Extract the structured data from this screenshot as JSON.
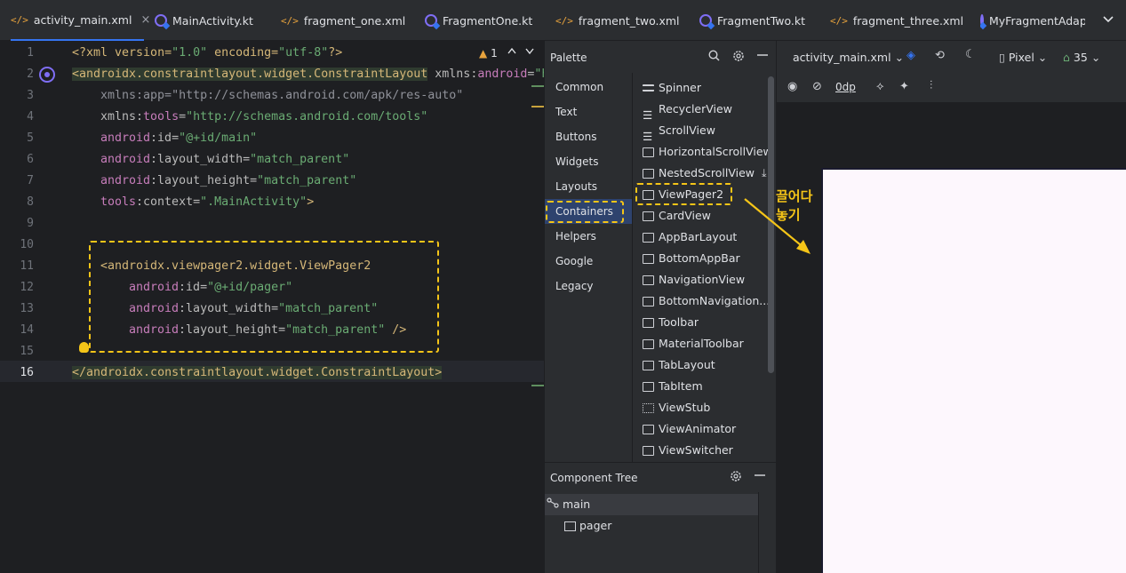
{
  "tabs": [
    {
      "label": "activity_main.xml",
      "icon": "xml-icon",
      "active": true,
      "closable": true
    },
    {
      "label": "MainActivity.kt",
      "icon": "kotlin-class-icon"
    },
    {
      "label": "fragment_one.xml",
      "icon": "xml-icon"
    },
    {
      "label": "FragmentOne.kt",
      "icon": "kotlin-class-icon"
    },
    {
      "label": "fragment_two.xml",
      "icon": "xml-icon"
    },
    {
      "label": "FragmentTwo.kt",
      "icon": "kotlin-class-icon"
    },
    {
      "label": "fragment_three.xml",
      "icon": "xml-icon"
    },
    {
      "label": "MyFragmentAdapte",
      "icon": "kotlin-class-icon"
    }
  ],
  "tab_more": "⌄",
  "editor": {
    "warning_count": "1",
    "line_numbers": [
      "1",
      "2",
      "3",
      "4",
      "5",
      "6",
      "7",
      "8",
      "9",
      "10",
      "11",
      "12",
      "13",
      "14",
      "15",
      "16"
    ],
    "lines": {
      "l1_a": "<?xml version=",
      "l1_b": "\"1.0\"",
      "l1_c": " encoding=",
      "l1_d": "\"utf-8\"",
      "l1_e": "?>",
      "l2_a": "<androidx.constraintlayout.widget.ConstraintLayout",
      "l2_b": " xmlns:",
      "l2_c": "android",
      "l2_d": "=",
      "l2_e": "\"h",
      "l3_a": "xmlns:app=",
      "l3_b": "\"http://schemas.android.com/apk/res-auto\"",
      "l4_a": "xmlns:",
      "l4_b": "tools",
      "l4_c": "=",
      "l4_d": "\"http://schemas.android.com/tools\"",
      "l5_ns": "android",
      "l5_a": ":id=",
      "l5_b": "\"@+id/main\"",
      "l6_ns": "android",
      "l6_a": ":layout_width=",
      "l6_b": "\"match_parent\"",
      "l7_ns": "android",
      "l7_a": ":layout_height=",
      "l7_b": "\"match_parent\"",
      "l8_ns": "tools",
      "l8_a": ":context=",
      "l8_b": "\".MainActivity\"",
      "l8_c": ">",
      "l11_a": "<androidx.viewpager2.widget.ViewPager2",
      "l12_ns": "android",
      "l12_a": ":id=",
      "l12_b": "\"@+id/pager\"",
      "l13_ns": "android",
      "l13_a": ":layout_width=",
      "l13_b": "\"match_parent\"",
      "l14_ns": "android",
      "l14_a": ":layout_height=",
      "l14_b": "\"match_parent\"",
      "l14_c": " />",
      "l16_a": "</androidx.constraintlayout.widget.ConstraintLayout>"
    }
  },
  "palette": {
    "title": "Palette",
    "categories": [
      "Common",
      "Text",
      "Buttons",
      "Widgets",
      "Layouts",
      "Containers",
      "Helpers",
      "Google",
      "Legacy"
    ],
    "selected_category": "Containers",
    "items": [
      "Spinner",
      "RecyclerView",
      "ScrollView",
      "HorizontalScrollView",
      "NestedScrollView",
      "ViewPager2",
      "CardView",
      "AppBarLayout",
      "BottomAppBar",
      "NavigationView",
      "BottomNavigation...",
      "Toolbar",
      "MaterialToolbar",
      "TabLayout",
      "TabItem",
      "ViewStub",
      "ViewAnimator",
      "ViewSwitcher"
    ]
  },
  "component_tree": {
    "title": "Component Tree",
    "nodes": [
      "main",
      "pager"
    ]
  },
  "design": {
    "file_select": "activity_main.xml",
    "device": "Pixel",
    "api_level": "35",
    "margin_value": "0dp"
  },
  "annotation": {
    "line1": "끌어다",
    "line2": "놓기",
    "color": "#f5c518"
  }
}
